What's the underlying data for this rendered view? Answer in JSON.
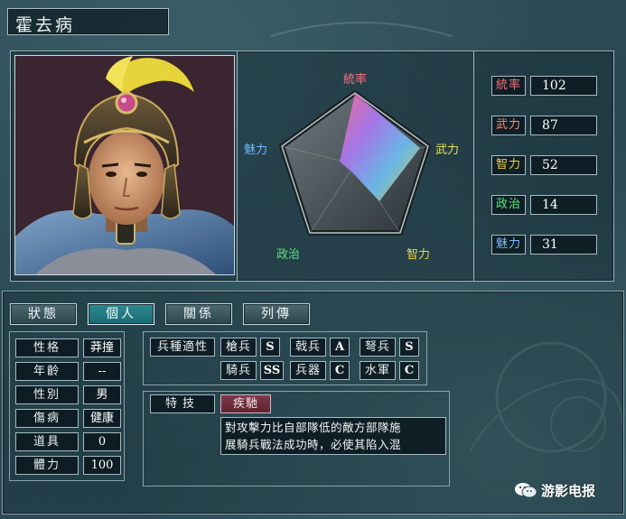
{
  "character": {
    "name": "霍去病"
  },
  "radar": {
    "labels": {
      "top": "統率",
      "right": "武力",
      "bottom_right": "智力",
      "bottom_left": "政治",
      "left": "魅力"
    },
    "colors": {
      "top": "#ff6f7c",
      "right": "#e6e05a",
      "bottom_right": "#f0d24a",
      "bottom_left": "#5fe07a",
      "left": "#6fb5ff"
    }
  },
  "stats": [
    {
      "label": "統率",
      "value": "102",
      "color": "#ff6f7c"
    },
    {
      "label": "武力",
      "value": "87",
      "color": "#ff8a70"
    },
    {
      "label": "智力",
      "value": "52",
      "color": "#f0d24a"
    },
    {
      "label": "政治",
      "value": "14",
      "color": "#62e27e"
    },
    {
      "label": "魅力",
      "value": "31",
      "color": "#7ab8ff"
    }
  ],
  "tabs": [
    {
      "label": "狀態",
      "active": false
    },
    {
      "label": "個人",
      "active": true
    },
    {
      "label": "關係",
      "active": false
    },
    {
      "label": "列傳",
      "active": false
    }
  ],
  "personal": [
    {
      "label": "性格",
      "value": "莽撞"
    },
    {
      "label": "年齡",
      "value": "--"
    },
    {
      "label": "性別",
      "value": "男"
    },
    {
      "label": "傷病",
      "value": "健康"
    },
    {
      "label": "道具",
      "value": "0"
    },
    {
      "label": "體力",
      "value": "100"
    }
  ],
  "troops": {
    "header": "兵種適性",
    "row1": [
      {
        "type": "槍兵",
        "grade": "S"
      },
      {
        "type": "戟兵",
        "grade": "A"
      },
      {
        "type": "弩兵",
        "grade": "S"
      }
    ],
    "row2": [
      {
        "type": "騎兵",
        "grade": "SS"
      },
      {
        "type": "兵器",
        "grade": "C"
      },
      {
        "type": "水軍",
        "grade": "C"
      }
    ]
  },
  "skill": {
    "header": "特技",
    "name": "疾馳",
    "desc_line1": "對攻擊力比自部隊低的敵方部隊施",
    "desc_line2": "展騎兵戰法成功時，必使其陷入混"
  },
  "watermark": {
    "text": "游影电报",
    "icon": "wechat-icon"
  }
}
